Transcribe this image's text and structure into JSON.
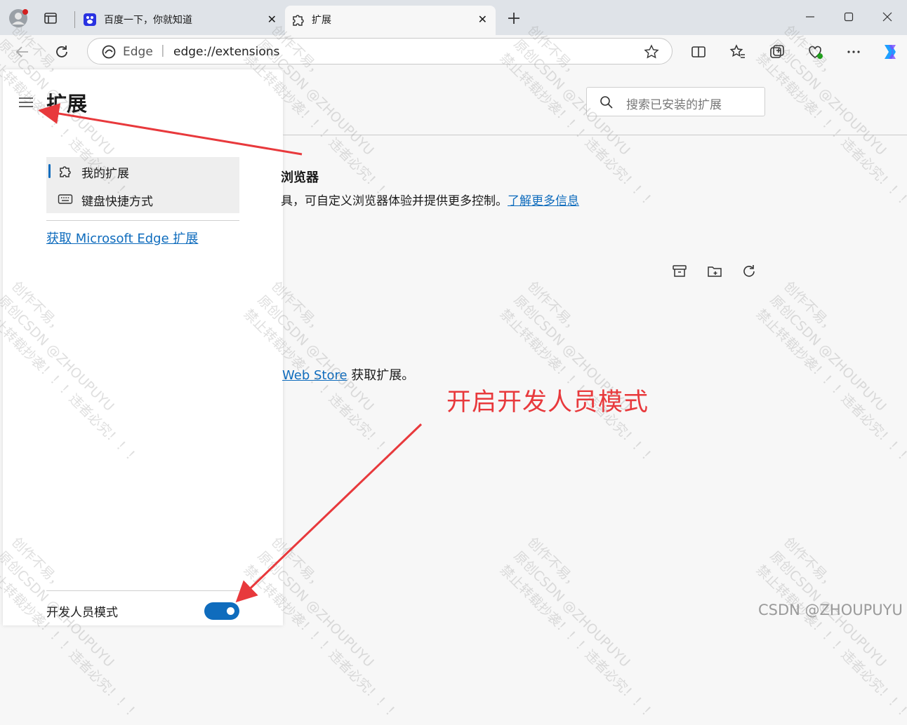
{
  "window": {
    "tabs": [
      {
        "title": "百度一下，你就知道",
        "icon": "baidu-icon"
      },
      {
        "title": "扩展",
        "icon": "puzzle-icon"
      }
    ]
  },
  "address_bar": {
    "site_label": "Edge",
    "separator": "|",
    "url": "edge://extensions"
  },
  "sidebar": {
    "title": "扩展",
    "nav": [
      {
        "label": "我的扩展",
        "icon": "puzzle-icon"
      },
      {
        "label": "键盘快捷方式",
        "icon": "keyboard-icon"
      }
    ],
    "get_extensions_link": "获取 Microsoft Edge 扩展",
    "developer_mode_label": "开发人员模式",
    "developer_mode_on": true
  },
  "main": {
    "search_placeholder": "搜索已安装的扩展",
    "heading": "浏览器",
    "description": "具，可自定义浏览器体验并提供更多控制。",
    "learn_more": "了解更多信息",
    "store_link": "Web Store",
    "store_suffix": " 获取扩展。"
  },
  "annotation": {
    "text": "开启开发人员模式",
    "color": "#e8393c"
  },
  "watermark": {
    "line1": "创作不易，",
    "line2": "原创CSDN @ZHOUPUYU",
    "line3": "禁止转载抄袭！！！违者必究！！！",
    "footer": "CSDN @ZHOUPUYU"
  },
  "colors": {
    "accent": "#0f6cbd",
    "titlebar": "#dfe3e8",
    "annotation": "#e8393c"
  }
}
